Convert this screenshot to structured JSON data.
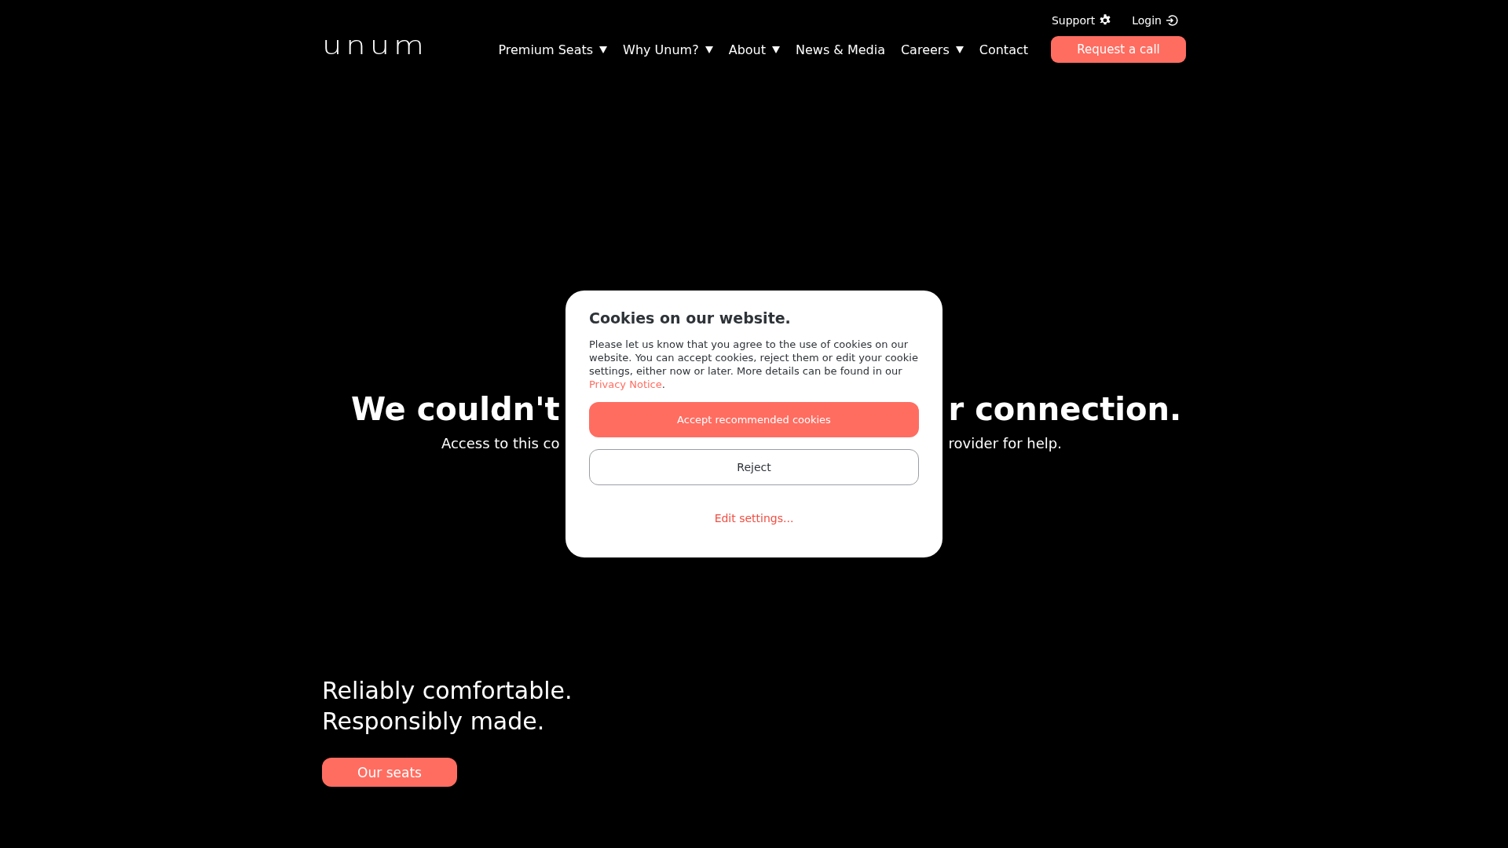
{
  "header": {
    "logo": "unum",
    "top_links": [
      {
        "label": "Support"
      },
      {
        "label": "Login"
      }
    ],
    "nav": [
      {
        "label": "Premium Seats",
        "dropdown": true
      },
      {
        "label": "Why Unum?",
        "dropdown": true
      },
      {
        "label": "About",
        "dropdown": true
      },
      {
        "label": "News & Media",
        "dropdown": false
      },
      {
        "label": "Careers",
        "dropdown": true
      },
      {
        "label": "Contact",
        "dropdown": false
      }
    ],
    "cta": "Request a call"
  },
  "error": {
    "heading_left": "We couldn't",
    "heading_right": "r connection.",
    "text_left": "Access to this co",
    "text_right": "rovider for help."
  },
  "hero": {
    "lines": [
      "Reliably comfortable.",
      "Responsibly made."
    ],
    "button": "Our seats"
  },
  "cookie_dialog": {
    "title": "Cookies on our website.",
    "body": "Please let us know that you agree to the use of cookies on our website. You can accept cookies, reject them or edit your cookie settings, either now or later. More details can be found in our",
    "link": "Privacy Notice",
    "link_end": ".",
    "accept": "Accept recommended cookies",
    "reject": "Reject",
    "edit": "Edit settings..."
  }
}
